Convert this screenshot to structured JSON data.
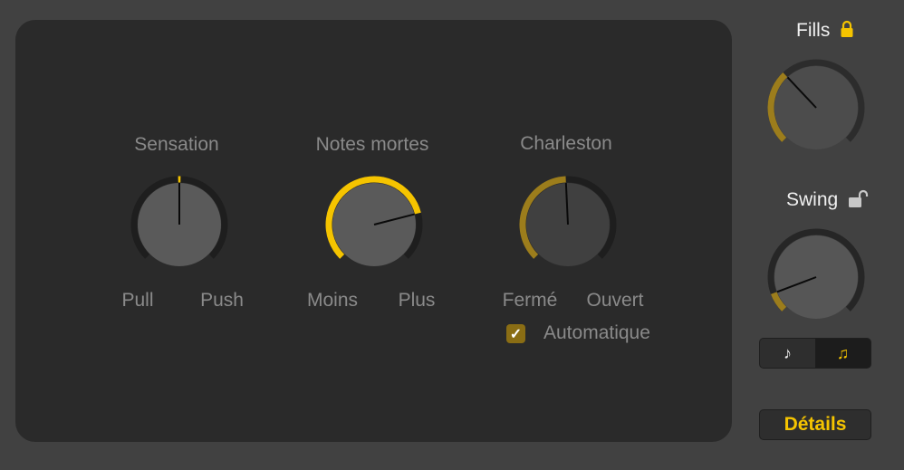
{
  "colors": {
    "accent": "#f5c400",
    "accent_dim": "#9c7d1c",
    "track": "#1e1e1e",
    "knob": "#5a5a5a"
  },
  "knobs": [
    {
      "id": "sensation",
      "title": "Sensation",
      "min_label": "Pull",
      "max_label": "Push",
      "value": 0.5,
      "bipolar": true,
      "active": true
    },
    {
      "id": "notes",
      "title": "Notes mortes",
      "min_label": "Moins",
      "max_label": "Plus",
      "value": 0.78,
      "bipolar": false,
      "active": true
    },
    {
      "id": "charleston",
      "title": "Charleston",
      "min_label": "Fermé",
      "max_label": "Ouvert",
      "value": 0.49,
      "bipolar": false,
      "active": false
    }
  ],
  "automatic": {
    "label": "Automatique",
    "checked": true
  },
  "fills": {
    "title": "Fills",
    "locked": true,
    "value": 0.34
  },
  "swing": {
    "title": "Swing",
    "locked": false,
    "value": 0.09
  },
  "note_toggle": {
    "options": [
      "♪",
      "♫"
    ],
    "selected": 1
  },
  "details_label": "Détails"
}
